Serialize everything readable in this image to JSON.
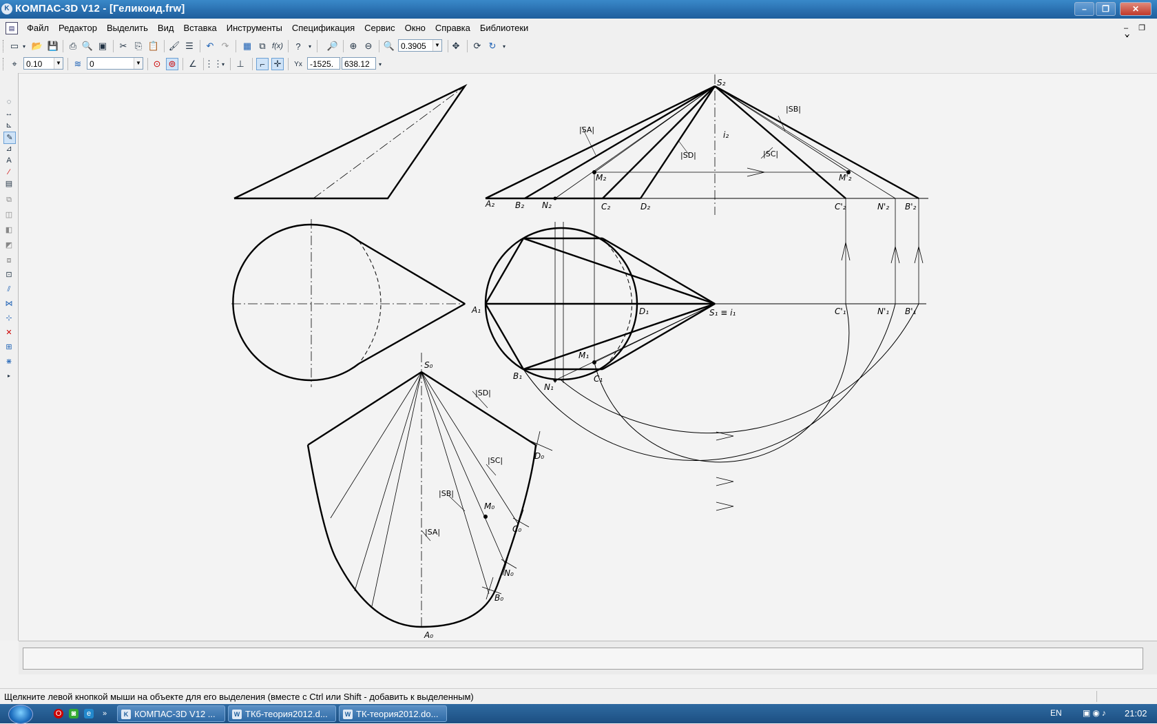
{
  "window": {
    "title": "КОМПАС-3D V12 - [Геликоид.frw]",
    "app_icon": "kompas-icon"
  },
  "menu": {
    "items": [
      "Файл",
      "Редактор",
      "Выделить",
      "Вид",
      "Вставка",
      "Инструменты",
      "Спецификация",
      "Сервис",
      "Окно",
      "Справка",
      "Библиотеки"
    ],
    "mdi_controls": "– ❐ ✕"
  },
  "toolbar": {
    "zoom_value": "0.3905",
    "line_step": "0.10",
    "layer": "0",
    "coord_x": "-1525.",
    "coord_y": "638.12"
  },
  "drawing": {
    "labels": {
      "S2": "S₂",
      "i2": "i₂",
      "A2": "A₂",
      "B2": "B₂",
      "N2": "N₂",
      "C2": "C₂",
      "D2": "D₂",
      "M2": "M₂",
      "M2p": "M'₂",
      "C2p": "C'₂",
      "N2p": "N'₂",
      "B2p": "B'₂",
      "A1": "A₁",
      "B1": "B₁",
      "N1": "N₁",
      "C1": "C₁",
      "D1": "D₁",
      "M1": "M₁",
      "S1": "S₁ ≡ i₁",
      "C1p": "C'₁",
      "N1p": "N'₁",
      "B1p": "B'₁",
      "S0": "S₀",
      "D0": "D₀",
      "M0": "M₀",
      "C0": "C₀",
      "N0": "N₀",
      "B0": "B₀",
      "A0": "A₀",
      "SA_top": "|SA|",
      "SB_top": "|SB|",
      "SC_top": "|SC|",
      "SD_top": "|SD|",
      "SD_dev": "|SD|",
      "SC_dev": "|SC|",
      "SB_dev": "|SB|",
      "SA_dev": "|SA|"
    }
  },
  "status": {
    "hint": "Щелкните левой кнопкой мыши на объекте для его выделения (вместе с Ctrl или Shift - добавить к выделенным)"
  },
  "taskbar": {
    "tasks": [
      {
        "label": "КОМПАС-3D V12 ...",
        "icon": "kompas-icon"
      },
      {
        "label": "ТКб-теория2012.d...",
        "icon": "word-icon"
      },
      {
        "label": "ТК-теория2012.do...",
        "icon": "word-icon"
      }
    ],
    "language": "EN",
    "time": "21:02"
  }
}
